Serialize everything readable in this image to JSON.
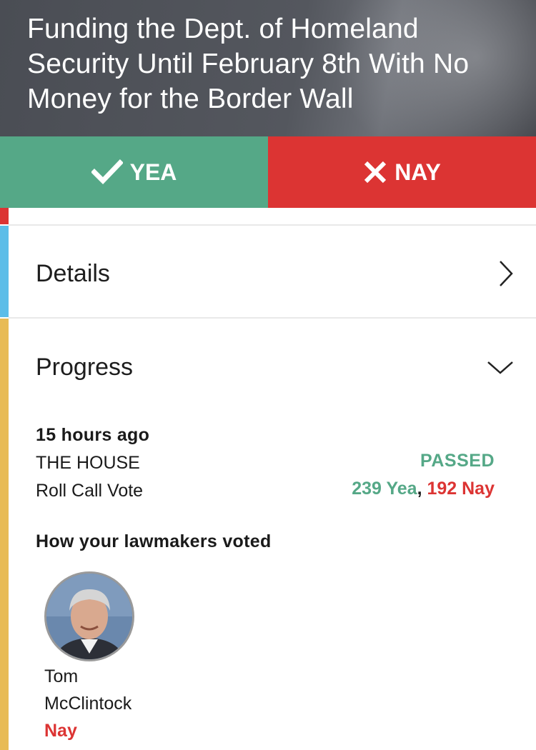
{
  "header": {
    "title": "Funding the Dept. of Homeland Security Until February 8th With No Money for the Border Wall"
  },
  "vote_buttons": {
    "yea_label": "YEA",
    "yea_icon": "checkmark-icon",
    "yea_color": "#55a887",
    "nay_label": "NAY",
    "nay_icon": "x-icon",
    "nay_color": "#dc3433"
  },
  "details": {
    "title": "Details",
    "icon": "chevron-right-icon"
  },
  "progress": {
    "title": "Progress",
    "icon": "chevron-down-icon",
    "time": "15 hours ago",
    "chamber": "THE HOUSE",
    "vote_type": "Roll Call Vote",
    "status": "PASSED",
    "yea_count": "239 Yea",
    "separator": ",",
    "nay_count": "192 Nay"
  },
  "lawmakers": {
    "label": "How your lawmakers voted",
    "items": [
      {
        "first_name": "Tom",
        "last_name": "McClintock",
        "vote": "Nay"
      }
    ]
  },
  "colors": {
    "accent_red": "#dc3433",
    "accent_blue": "#5cbde8",
    "accent_yellow": "#e8bb55"
  }
}
